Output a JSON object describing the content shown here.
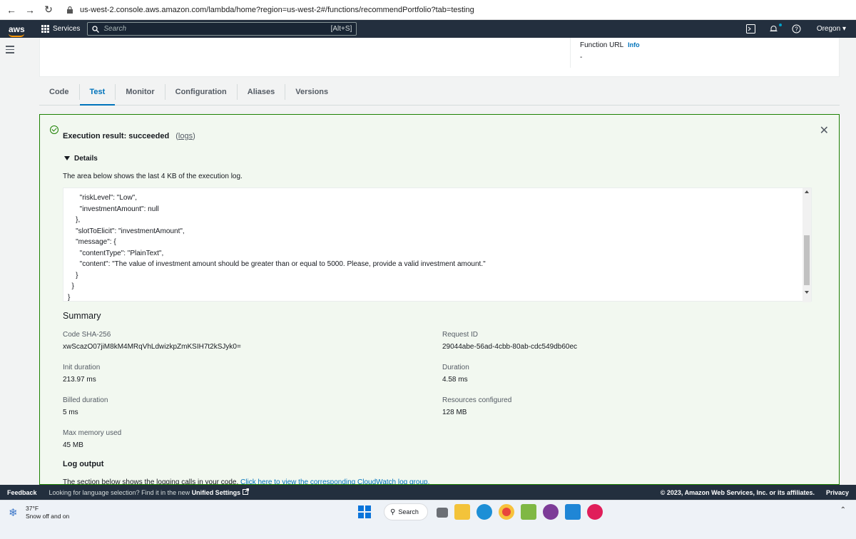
{
  "browser": {
    "url": "us-west-2.console.aws.amazon.com/lambda/home?region=us-west-2#/functions/recommendPortfolio?tab=testing"
  },
  "aws_nav": {
    "logo": "aws",
    "services": "Services",
    "search_placeholder": "Search",
    "search_shortcut": "[Alt+S]",
    "region": "Oregon"
  },
  "top_panel": {
    "function_url_label": "Function URL",
    "info_label": "Info",
    "function_url_value": "-"
  },
  "tabs": [
    {
      "label": "Code"
    },
    {
      "label": "Test"
    },
    {
      "label": "Monitor"
    },
    {
      "label": "Configuration"
    },
    {
      "label": "Aliases"
    },
    {
      "label": "Versions"
    }
  ],
  "result": {
    "title": "Execution result: succeeded",
    "logs_prefix": "(",
    "logs_link": "logs",
    "logs_suffix": ")",
    "details_label": "Details",
    "area_desc": "The area below shows the last 4 KB of the execution log.",
    "log_text": "      \"riskLevel\": \"Low\",\n      \"investmentAmount\": null\n    },\n    \"slotToElicit\": \"investmentAmount\",\n    \"message\": {\n      \"contentType\": \"PlainText\",\n      \"content\": \"The value of investment amount should be greater than or equal to 5000. Please, provide a valid investment amount.\"\n    }\n  }\n}",
    "summary_title": "Summary",
    "summary": {
      "code_sha_label": "Code SHA-256",
      "code_sha_value": "xwScazO07jiM8kM4MRqVhLdwizkpZmKSIH7t2kSJyk0=",
      "request_id_label": "Request ID",
      "request_id_value": "29044abe-56ad-4cbb-80ab-cdc549db60ec",
      "init_duration_label": "Init duration",
      "init_duration_value": "213.97 ms",
      "duration_label": "Duration",
      "duration_value": "4.58 ms",
      "billed_duration_label": "Billed duration",
      "billed_duration_value": "5 ms",
      "resources_label": "Resources configured",
      "resources_value": "128 MB",
      "max_memory_label": "Max memory used",
      "max_memory_value": "45 MB"
    },
    "log_output_title": "Log output",
    "log_output_desc": "The section below shows the logging calls in your code.",
    "log_output_link": "Click here to view the corresponding CloudWatch log group."
  },
  "footer": {
    "feedback": "Feedback",
    "lang_text": "Looking for language selection? Find it in the new",
    "unified_settings": "Unified Settings",
    "copyright": "© 2023, Amazon Web Services, Inc. or its affiliates.",
    "privacy": "Privacy"
  },
  "taskbar": {
    "temperature": "37°F",
    "weather_desc": "Snow off and on",
    "search_label": "Search"
  },
  "colors": {
    "aws_nav_bg": "#232f3e",
    "accent": "#0073bb",
    "success": "#1d8102",
    "brand_orange": "#ff9900"
  }
}
